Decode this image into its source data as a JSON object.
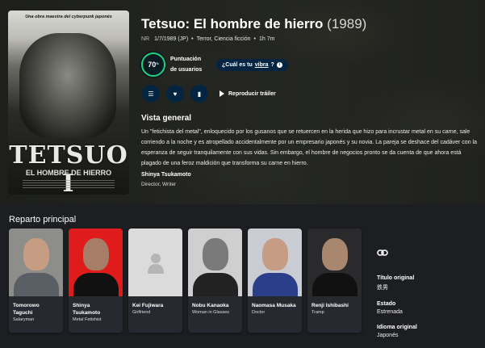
{
  "poster": {
    "tagline": "Una obra maestra del cyberpunk japonés",
    "title": "TETSUO I",
    "subtitle": "EL HOMBRE DE HIERRO"
  },
  "movie": {
    "title": "Tetsuo: El hombre de hierro",
    "year": "(1989)",
    "certification": "NR",
    "release": "1/7/1989 (JP)",
    "bullet": "•",
    "genres": "Terror, Ciencia ficción",
    "runtime": "1h 7m"
  },
  "score": {
    "value": "70",
    "unit": "%",
    "label": "Puntuación de usuarios",
    "vibe_prefix": "¿Cuál es tu ",
    "vibe_word": "vibra",
    "vibe_suffix": "?",
    "ring_color": "#21d07a"
  },
  "actions": {
    "list_icon": "list-icon",
    "favorite_icon": "heart-icon",
    "watchlist_icon": "bookmark-icon",
    "trailer_label": "Reproducir tráiler"
  },
  "overview": {
    "heading": "Vista general",
    "text": "Un \"fetichista del metal\", enloquecido por los gusanos que se retuercen en la herida que hizo para incrustar metal en su carne, sale corriendo a la noche y es atropellado accidentalmente por un empresario japonés y su novia. La pareja se deshace del cadáver con la esperanza de seguir tranquilamente con sus vidas. Sin embargo, el hombre de negocios pronto se da cuenta de que ahora está plagado de una feroz maldición que transforma su carne en hierro.",
    "director_name": "Shinya Tsukamoto",
    "director_role": "Director, Writer"
  },
  "cast": {
    "heading": "Reparto principal",
    "members": [
      {
        "name": "Tomorowo Taguchi",
        "character": "Salaryman"
      },
      {
        "name": "Shinya Tsukamoto",
        "character": "Metal Fetishist"
      },
      {
        "name": "Kei Fujiwara",
        "character": "Girlfriend"
      },
      {
        "name": "Nobu Kanaoka",
        "character": "Woman in Glasses"
      },
      {
        "name": "Naomasa Musaka",
        "character": "Doctor"
      },
      {
        "name": "Renji Ishibashi",
        "character": "Tramp"
      }
    ]
  },
  "facts": {
    "original_title_label": "Título original",
    "original_title": "鉄男",
    "status_label": "Estado",
    "status": "Estrenada",
    "language_label": "Idioma original",
    "language": "Japonés"
  }
}
